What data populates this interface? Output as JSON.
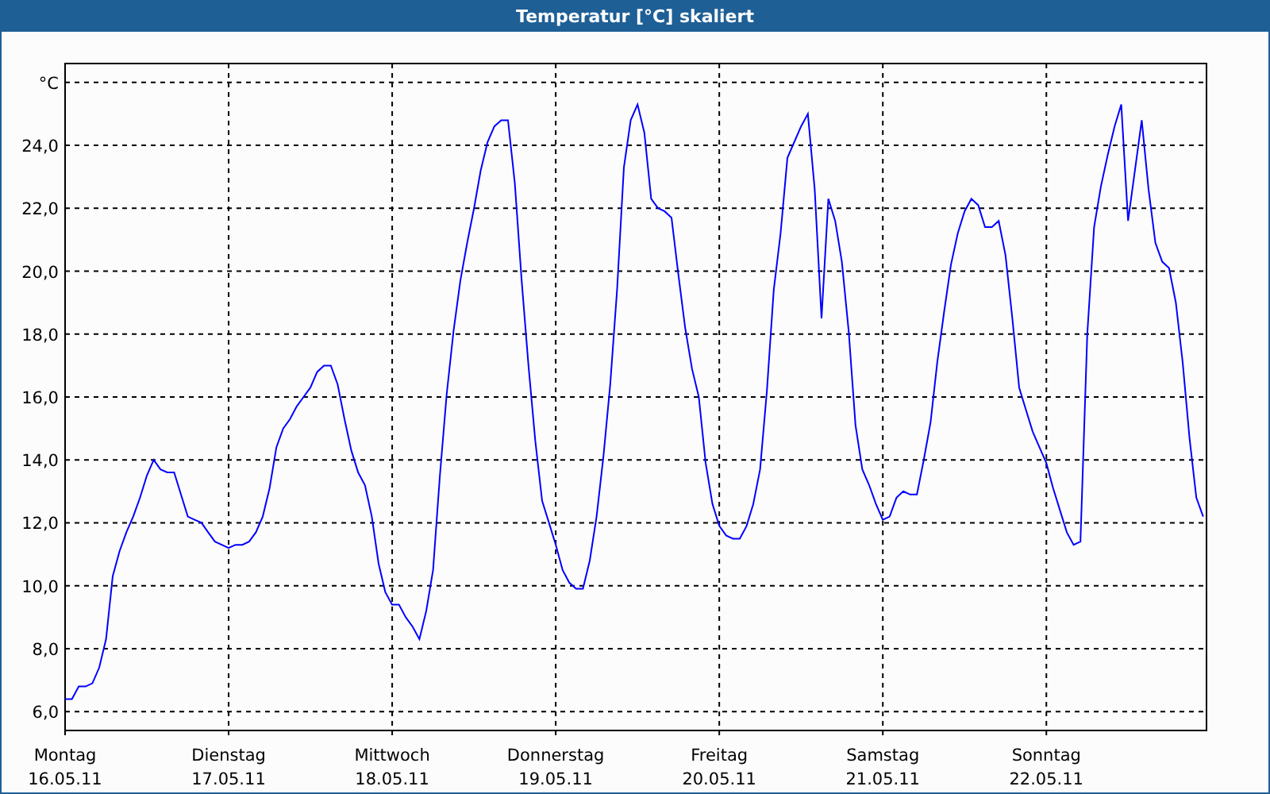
{
  "window": {
    "title": "Temperatur [°C] skaliert"
  },
  "chart": {
    "chart_data": {
      "type": "line",
      "categories": [
        "Montag\n16.05.11",
        null,
        null,
        null,
        null,
        null,
        null,
        null,
        null,
        null,
        null,
        null,
        null,
        null,
        null,
        null,
        null,
        null,
        null,
        null,
        null,
        null,
        null,
        null,
        "Dienstag\n17.05.11",
        null,
        null,
        null,
        null,
        null,
        null,
        null,
        null,
        null,
        null,
        null,
        null,
        null,
        null,
        null,
        null,
        null,
        null,
        null,
        null,
        null,
        null,
        null,
        "Mittwoch\n18.05.11",
        null,
        null,
        null,
        null,
        null,
        null,
        null,
        null,
        null,
        null,
        null,
        null,
        null,
        null,
        null,
        null,
        null,
        null,
        null,
        null,
        null,
        null,
        null,
        "Donnerstag\n19.05.11",
        null,
        null,
        null,
        null,
        null,
        null,
        null,
        null,
        null,
        null,
        null,
        null,
        null,
        null,
        null,
        null,
        null,
        null,
        null,
        null,
        null,
        null,
        null,
        "Freitag\n20.05.11",
        null,
        null,
        null,
        null,
        null,
        null,
        null,
        null,
        null,
        null,
        null,
        null,
        null,
        null,
        null,
        null,
        null,
        null,
        null,
        null,
        null,
        null,
        null,
        "Samstag\n21.05.11",
        null,
        null,
        null,
        null,
        null,
        null,
        null,
        null,
        null,
        null,
        null,
        null,
        null,
        null,
        null,
        null,
        null,
        null,
        null,
        null,
        null,
        null,
        null,
        "Sonntag\n22.05.11",
        null,
        null,
        null,
        null,
        null,
        null,
        null,
        null,
        null,
        null,
        null,
        null,
        null,
        null,
        null,
        null,
        null,
        null,
        null,
        null,
        null,
        null,
        null
      ],
      "series": [
        {
          "color": "#0000ff",
          "values": [
            6.4,
            6.4,
            6.8,
            6.8,
            6.9,
            7.4,
            8.3,
            10.3,
            11.1,
            11.7,
            12.2,
            12.8,
            13.5,
            14.0,
            13.7,
            13.6,
            13.6,
            12.9,
            12.2,
            12.1,
            12.0,
            11.7,
            11.4,
            11.3,
            11.2,
            11.3,
            11.3,
            11.4,
            11.7,
            12.2,
            13.1,
            14.4,
            15.0,
            15.3,
            15.7,
            16.0,
            16.3,
            16.8,
            17.0,
            17.0,
            16.4,
            15.3,
            14.3,
            13.6,
            13.2,
            12.2,
            10.7,
            9.8,
            9.4,
            9.4,
            9.0,
            8.7,
            8.3,
            9.2,
            10.5,
            13.5,
            16.1,
            18.1,
            19.7,
            20.9,
            22.0,
            23.2,
            24.1,
            24.6,
            24.8,
            24.8,
            22.8,
            19.7,
            17.0,
            14.6,
            12.7,
            12.0,
            11.3,
            10.5,
            10.1,
            9.9,
            9.9,
            10.8,
            12.2,
            14.1,
            16.4,
            19.4,
            23.3,
            24.8,
            25.3,
            24.4,
            22.3,
            22.0,
            21.9,
            21.7,
            19.9,
            18.2,
            16.9,
            16.0,
            13.9,
            12.6,
            11.9,
            11.6,
            11.5,
            11.5,
            11.9,
            12.6,
            13.7,
            16.2,
            19.4,
            21.2,
            23.6,
            24.1,
            24.6,
            25.0,
            22.6,
            18.5,
            22.3,
            21.6,
            20.3,
            18.1,
            15.1,
            13.7,
            13.2,
            12.6,
            12.1,
            12.2,
            12.8,
            13.0,
            12.9,
            12.9,
            14.0,
            15.2,
            17.1,
            18.7,
            20.2,
            21.2,
            21.9,
            22.3,
            22.1,
            21.4,
            21.4,
            21.6,
            20.5,
            18.5,
            16.3,
            15.6,
            14.9,
            14.4,
            13.9,
            13.1,
            12.4,
            11.7,
            11.3,
            11.4,
            18.0,
            21.4,
            22.7,
            23.7,
            24.6,
            25.3,
            21.6,
            23.2,
            24.8,
            22.6,
            20.9,
            20.3,
            20.1,
            19.0,
            17.1,
            14.7,
            12.8,
            12.2
          ]
        }
      ],
      "grid": true,
      "ylim": [
        5.4,
        26.6
      ],
      "yticks": [
        {
          "value": 6,
          "label": "6,0"
        },
        {
          "value": 8,
          "label": "8,0"
        },
        {
          "value": 10,
          "label": "10,0"
        },
        {
          "value": 12,
          "label": "12,0"
        },
        {
          "value": 14,
          "label": "14,0"
        },
        {
          "value": 16,
          "label": "16,0"
        },
        {
          "value": 18,
          "label": "18,0"
        },
        {
          "value": 20,
          "label": "20,0"
        },
        {
          "value": 22,
          "label": "22,0"
        },
        {
          "value": 24,
          "label": "24,0"
        },
        {
          "value": 26,
          "label": "°C"
        }
      ]
    }
  }
}
